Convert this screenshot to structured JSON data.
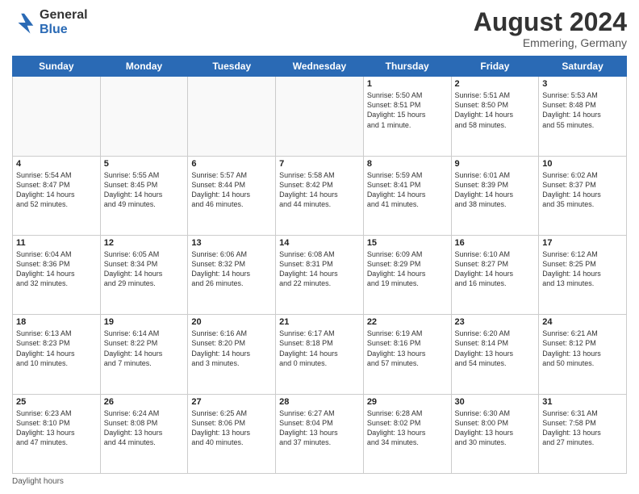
{
  "header": {
    "logo_general": "General",
    "logo_blue": "Blue",
    "title": "August 2024",
    "location": "Emmering, Germany"
  },
  "days_of_week": [
    "Sunday",
    "Monday",
    "Tuesday",
    "Wednesday",
    "Thursday",
    "Friday",
    "Saturday"
  ],
  "weeks": [
    [
      {
        "day": "",
        "info": ""
      },
      {
        "day": "",
        "info": ""
      },
      {
        "day": "",
        "info": ""
      },
      {
        "day": "",
        "info": ""
      },
      {
        "day": "1",
        "info": "Sunrise: 5:50 AM\nSunset: 8:51 PM\nDaylight: 15 hours\nand 1 minute."
      },
      {
        "day": "2",
        "info": "Sunrise: 5:51 AM\nSunset: 8:50 PM\nDaylight: 14 hours\nand 58 minutes."
      },
      {
        "day": "3",
        "info": "Sunrise: 5:53 AM\nSunset: 8:48 PM\nDaylight: 14 hours\nand 55 minutes."
      }
    ],
    [
      {
        "day": "4",
        "info": "Sunrise: 5:54 AM\nSunset: 8:47 PM\nDaylight: 14 hours\nand 52 minutes."
      },
      {
        "day": "5",
        "info": "Sunrise: 5:55 AM\nSunset: 8:45 PM\nDaylight: 14 hours\nand 49 minutes."
      },
      {
        "day": "6",
        "info": "Sunrise: 5:57 AM\nSunset: 8:44 PM\nDaylight: 14 hours\nand 46 minutes."
      },
      {
        "day": "7",
        "info": "Sunrise: 5:58 AM\nSunset: 8:42 PM\nDaylight: 14 hours\nand 44 minutes."
      },
      {
        "day": "8",
        "info": "Sunrise: 5:59 AM\nSunset: 8:41 PM\nDaylight: 14 hours\nand 41 minutes."
      },
      {
        "day": "9",
        "info": "Sunrise: 6:01 AM\nSunset: 8:39 PM\nDaylight: 14 hours\nand 38 minutes."
      },
      {
        "day": "10",
        "info": "Sunrise: 6:02 AM\nSunset: 8:37 PM\nDaylight: 14 hours\nand 35 minutes."
      }
    ],
    [
      {
        "day": "11",
        "info": "Sunrise: 6:04 AM\nSunset: 8:36 PM\nDaylight: 14 hours\nand 32 minutes."
      },
      {
        "day": "12",
        "info": "Sunrise: 6:05 AM\nSunset: 8:34 PM\nDaylight: 14 hours\nand 29 minutes."
      },
      {
        "day": "13",
        "info": "Sunrise: 6:06 AM\nSunset: 8:32 PM\nDaylight: 14 hours\nand 26 minutes."
      },
      {
        "day": "14",
        "info": "Sunrise: 6:08 AM\nSunset: 8:31 PM\nDaylight: 14 hours\nand 22 minutes."
      },
      {
        "day": "15",
        "info": "Sunrise: 6:09 AM\nSunset: 8:29 PM\nDaylight: 14 hours\nand 19 minutes."
      },
      {
        "day": "16",
        "info": "Sunrise: 6:10 AM\nSunset: 8:27 PM\nDaylight: 14 hours\nand 16 minutes."
      },
      {
        "day": "17",
        "info": "Sunrise: 6:12 AM\nSunset: 8:25 PM\nDaylight: 14 hours\nand 13 minutes."
      }
    ],
    [
      {
        "day": "18",
        "info": "Sunrise: 6:13 AM\nSunset: 8:23 PM\nDaylight: 14 hours\nand 10 minutes."
      },
      {
        "day": "19",
        "info": "Sunrise: 6:14 AM\nSunset: 8:22 PM\nDaylight: 14 hours\nand 7 minutes."
      },
      {
        "day": "20",
        "info": "Sunrise: 6:16 AM\nSunset: 8:20 PM\nDaylight: 14 hours\nand 3 minutes."
      },
      {
        "day": "21",
        "info": "Sunrise: 6:17 AM\nSunset: 8:18 PM\nDaylight: 14 hours\nand 0 minutes."
      },
      {
        "day": "22",
        "info": "Sunrise: 6:19 AM\nSunset: 8:16 PM\nDaylight: 13 hours\nand 57 minutes."
      },
      {
        "day": "23",
        "info": "Sunrise: 6:20 AM\nSunset: 8:14 PM\nDaylight: 13 hours\nand 54 minutes."
      },
      {
        "day": "24",
        "info": "Sunrise: 6:21 AM\nSunset: 8:12 PM\nDaylight: 13 hours\nand 50 minutes."
      }
    ],
    [
      {
        "day": "25",
        "info": "Sunrise: 6:23 AM\nSunset: 8:10 PM\nDaylight: 13 hours\nand 47 minutes."
      },
      {
        "day": "26",
        "info": "Sunrise: 6:24 AM\nSunset: 8:08 PM\nDaylight: 13 hours\nand 44 minutes."
      },
      {
        "day": "27",
        "info": "Sunrise: 6:25 AM\nSunset: 8:06 PM\nDaylight: 13 hours\nand 40 minutes."
      },
      {
        "day": "28",
        "info": "Sunrise: 6:27 AM\nSunset: 8:04 PM\nDaylight: 13 hours\nand 37 minutes."
      },
      {
        "day": "29",
        "info": "Sunrise: 6:28 AM\nSunset: 8:02 PM\nDaylight: 13 hours\nand 34 minutes."
      },
      {
        "day": "30",
        "info": "Sunrise: 6:30 AM\nSunset: 8:00 PM\nDaylight: 13 hours\nand 30 minutes."
      },
      {
        "day": "31",
        "info": "Sunrise: 6:31 AM\nSunset: 7:58 PM\nDaylight: 13 hours\nand 27 minutes."
      }
    ]
  ],
  "footer": {
    "note": "Daylight hours"
  }
}
